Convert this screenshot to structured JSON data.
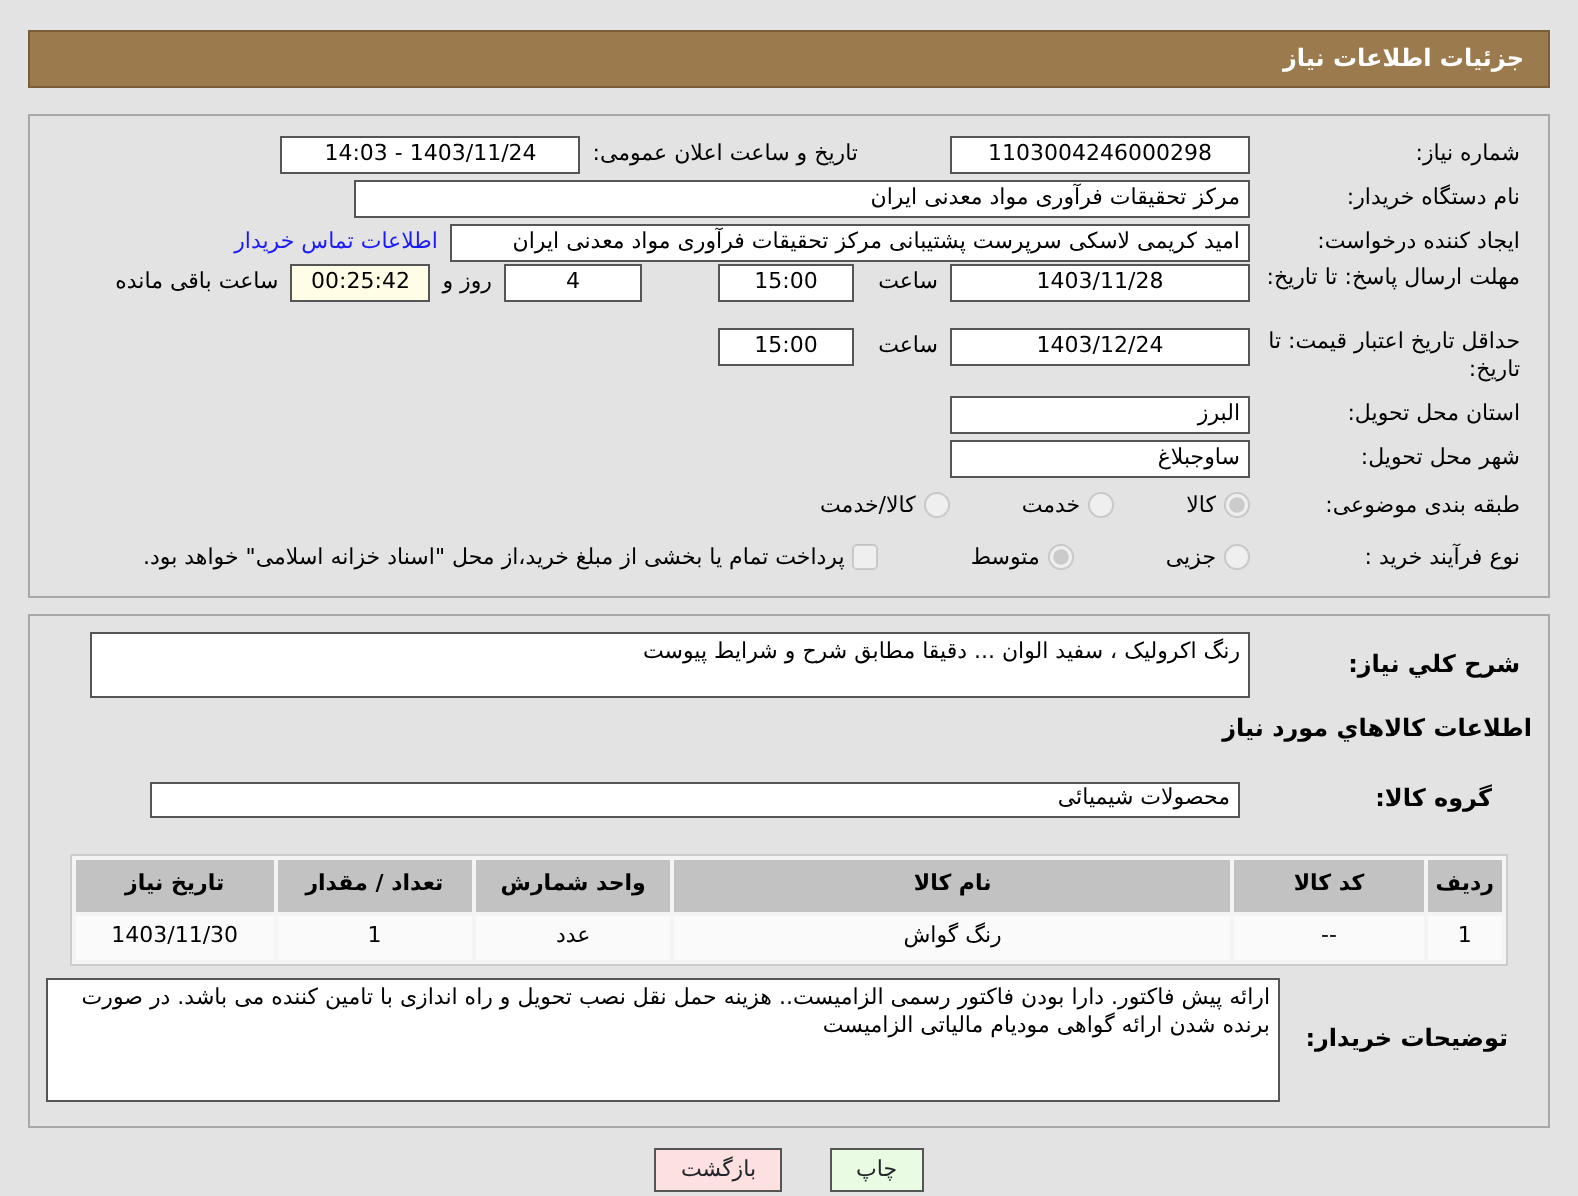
{
  "title": "جزئیات اطلاعات نیاز",
  "need_number": {
    "label": "شماره نیاز:",
    "value": "1103004246000298"
  },
  "announce": {
    "label": "تاریخ و ساعت اعلان عمومی:",
    "value": "1403/11/24 - 14:03"
  },
  "buyer": {
    "label": "نام دستگاه خریدار:",
    "value": "مرکز تحقیقات فرآوری مواد معدنی ایران"
  },
  "requester": {
    "label": "ایجاد کننده درخواست:",
    "value": "امید کریمی لاسکی سرپرست پشتیبانی مرکز تحقیقات فرآوری مواد معدنی ایران",
    "link": "اطلاعات تماس خریدار"
  },
  "deadline": {
    "label": "مهلت ارسال پاسخ: تا تاریخ:",
    "date": "1403/11/28",
    "time_label": "ساعت",
    "time": "15:00",
    "days": "4",
    "days_label": "روز و",
    "remaining": "00:25:42",
    "remaining_label": "ساعت باقی مانده"
  },
  "validity": {
    "label": "حداقل تاریخ اعتبار قیمت: تا تاریخ:",
    "date": "1403/12/24",
    "time_label": "ساعت",
    "time": "15:00"
  },
  "province": {
    "label": "استان محل تحویل:",
    "value": "البرز"
  },
  "city": {
    "label": "شهر محل تحویل:",
    "value": "ساوجبلاغ"
  },
  "category": {
    "label": "طبقه بندی موضوعی:",
    "options": [
      {
        "label": "کالا",
        "selected": true
      },
      {
        "label": "خدمت",
        "selected": false
      },
      {
        "label": "کالا/خدمت",
        "selected": false
      }
    ]
  },
  "process": {
    "label": "نوع فرآیند خرید :",
    "options": [
      {
        "label": "جزیی",
        "selected": false
      },
      {
        "label": "متوسط",
        "selected": true
      }
    ],
    "payment": {
      "label": "پرداخت تمام یا بخشی از مبلغ خرید،از محل \"اسناد خزانه اسلامی\" خواهد بود.",
      "checked": false
    }
  },
  "description": {
    "label": "شرح کلي نياز:",
    "value": "رنگ اکرولیک ، سفید الوان ... دقیقا مطابق شرح و شرایط پیوست"
  },
  "goods_heading": "اطلاعات کالاهاي مورد نياز",
  "group": {
    "label": "گروه کالا:",
    "value": "محصولات شیمیائی"
  },
  "table": {
    "columns": [
      "ردیف",
      "کد کالا",
      "نام کالا",
      "واحد شمارش",
      "تعداد / مقدار",
      "تاریخ نیاز"
    ],
    "rows": [
      [
        "1",
        "--",
        "رنگ گواش",
        "عدد",
        "1",
        "1403/11/30"
      ]
    ]
  },
  "notes": {
    "label": "توضیحات خریدار:",
    "value": "ارائه پیش فاکتور. دارا بودن فاکتور رسمی الزامیست.. هزینه حمل نقل نصب تحویل و راه اندازی با تامین کننده می باشد. در صورت برنده شدن ارائه گواهی مودیام مالیاتی الزامیست"
  },
  "buttons": [
    {
      "label": "چاپ",
      "kind": "print"
    },
    {
      "label": "بازگشت",
      "kind": "back"
    }
  ]
}
